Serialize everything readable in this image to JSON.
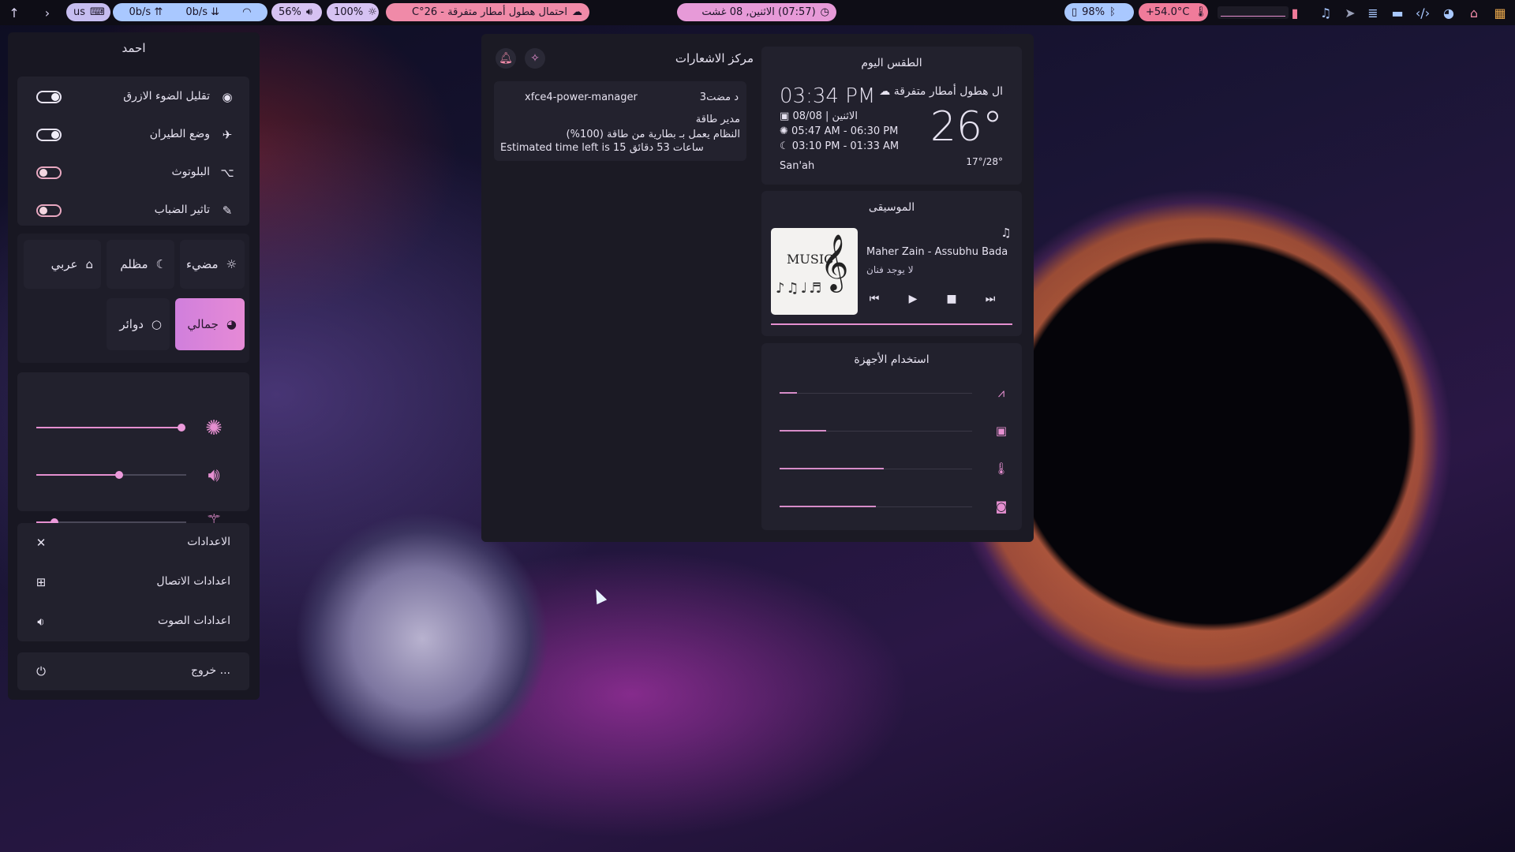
{
  "topbar": {
    "keyboard_layout": "us",
    "net_up": "0b/s",
    "net_down": "0b/s",
    "battery_percent": "56%",
    "volume_percent": "100%",
    "weather": "احتمال هطول أمطار متفرقة - 26°C",
    "datetime": "(07:57) الاثنين, 08 غشت",
    "disk_percent": "98%",
    "cpu_temp": "+54.0°C",
    "colors": {
      "workspace_pill": "#8fb6f0",
      "weather_pill": "#f08aa8",
      "clock_pill": "#e79ad8",
      "temp_pill": "#f07b9a",
      "net_pill": "#a9c8ff",
      "battery_pill": "#d6c2f2"
    }
  },
  "sidebar": {
    "user_name": "احمد",
    "toggles": [
      {
        "label": "تقليل الضوء الازرق",
        "icon": "eye-icon",
        "on": true
      },
      {
        "label": "وضع الطيران",
        "icon": "airplane-icon",
        "on": true
      },
      {
        "label": "البلوتوث",
        "icon": "bluetooth-icon",
        "on": false
      },
      {
        "label": "تاثير الضباب",
        "icon": "blur-icon",
        "on": false
      }
    ],
    "themes": [
      {
        "label": "مضيء"
      },
      {
        "label": "مظلم"
      },
      {
        "label": "عربي"
      },
      {
        "label": "جمالي",
        "active": true
      },
      {
        "label": "دوائر"
      }
    ],
    "sliders": [
      {
        "name": "brightness",
        "value": 100
      },
      {
        "name": "volume",
        "value": 55
      },
      {
        "name": "blur",
        "value": 12
      }
    ],
    "menu": [
      {
        "label": "الاعدادات",
        "icon": "tools-icon"
      },
      {
        "label": "اعدادات الاتصال",
        "icon": "network-icon"
      },
      {
        "label": "اعدادات الصوت",
        "icon": "speaker-icon"
      }
    ],
    "logout": "خروج ..."
  },
  "notifications": {
    "title": "مركز الاشعارات",
    "items": [
      {
        "app": "xfce4-power-manager",
        "time": "3د مضت",
        "summary": "مدير طاقة",
        "body_line1": "النظام يعمل بـ بطارية من طاقة (100%)",
        "body_line2": "Estimated time left is 15 ساعات 53 دقائق"
      }
    ]
  },
  "weather": {
    "title": "الطقس اليوم",
    "condition": "ال هطول أمطار متفرقة",
    "time": "03:34 PM",
    "date": "الاثنين | 08/08",
    "sun": "05:47 AM - 06:30 PM",
    "moon": "03:10 PM - 01:33 AM",
    "temp": "26°",
    "range": "17°/28°",
    "city": "San'ah"
  },
  "music": {
    "title": "الموسيقى",
    "track": "Maher Zain - Assubhu Bada",
    "artist": "لا يوجد فنان",
    "cover_text": "MUSIC",
    "progress": 0
  },
  "usage": {
    "title": "استخدام الأجهزة",
    "items": [
      {
        "name": "ram",
        "icon": "chart-icon",
        "value": 9
      },
      {
        "name": "cpu",
        "icon": "cpu-icon",
        "value": 24
      },
      {
        "name": "temp",
        "icon": "thermometer-icon",
        "value": 54
      },
      {
        "name": "disk",
        "icon": "disk-icon",
        "value": 50
      }
    ]
  }
}
